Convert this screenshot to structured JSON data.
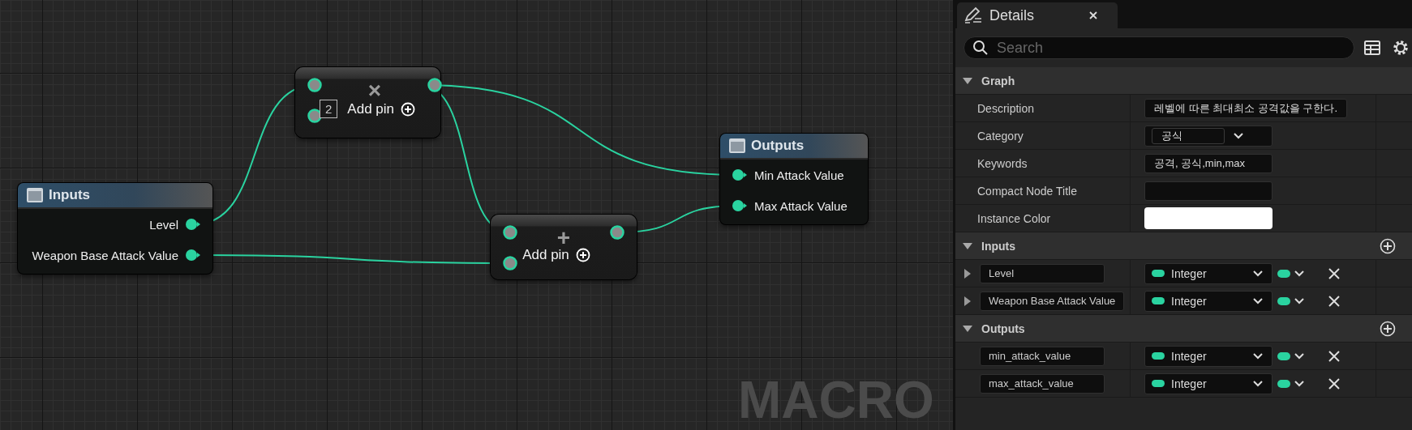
{
  "graph": {
    "nodes": [
      {
        "kind": "inputs",
        "title": "Inputs",
        "pins": [
          {
            "label": "Level"
          },
          {
            "label": "Weapon Base Attack Value"
          }
        ]
      },
      {
        "kind": "math",
        "symbol": "×",
        "badge": "2",
        "add_pin": "Add pin"
      },
      {
        "kind": "math",
        "symbol": "+",
        "add_pin": "Add pin"
      },
      {
        "kind": "outputs",
        "title": "Outputs",
        "pins": [
          {
            "label": "Min Attack Value"
          },
          {
            "label": "Max Attack Value"
          }
        ]
      }
    ],
    "watermark": "MACRO"
  },
  "details": {
    "tab": {
      "title": "Details"
    },
    "search": {
      "placeholder": "Search"
    },
    "sections": [
      {
        "kind": "properties",
        "title": "Graph",
        "expanded": true,
        "rows": [
          {
            "kind": "text",
            "label": "Description",
            "value": "레벨에 따른 최대최소 공격값을 구한다."
          },
          {
            "kind": "combo",
            "label": "Category",
            "value": "공식"
          },
          {
            "kind": "text",
            "label": "Keywords",
            "value": "공격, 공식,min,max"
          },
          {
            "kind": "text",
            "label": "Compact Node Title"
          },
          {
            "kind": "color",
            "label": "Instance Color",
            "color": "#ffffff"
          }
        ]
      },
      {
        "kind": "params",
        "title": "Inputs",
        "expanded": true,
        "params": [
          {
            "name": "Level",
            "type": "Integer",
            "expander": true
          },
          {
            "name": "Weapon Base Attack Value",
            "type": "Integer",
            "expander": true
          }
        ]
      },
      {
        "kind": "params",
        "title": "Outputs",
        "expanded": true,
        "params": [
          {
            "name": "min_attack_value",
            "type": "Integer",
            "expander": false
          },
          {
            "name": "max_attack_value",
            "type": "Integer",
            "expander": false
          }
        ]
      }
    ]
  }
}
